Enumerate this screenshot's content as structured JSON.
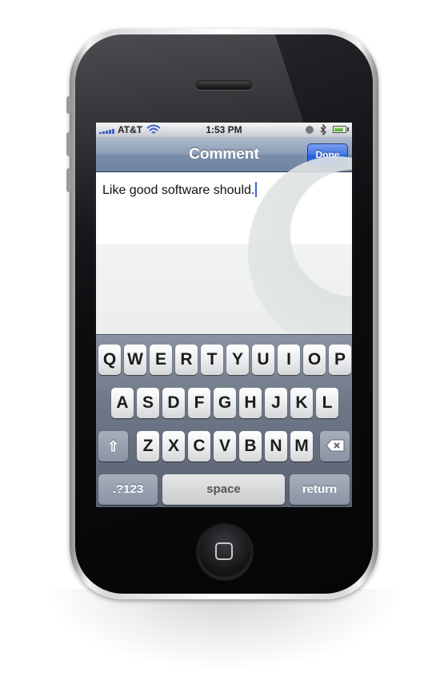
{
  "status_bar": {
    "carrier": "AT&T",
    "time": "1:53 PM",
    "icons": [
      "signal-icon",
      "wifi-icon",
      "alarm-icon",
      "bluetooth-icon",
      "battery-icon"
    ]
  },
  "nav_bar": {
    "title": "Comment",
    "done_label": "Done"
  },
  "comment": {
    "text": "Like good software should."
  },
  "keyboard": {
    "row1": [
      "Q",
      "W",
      "E",
      "R",
      "T",
      "Y",
      "U",
      "I",
      "O",
      "P"
    ],
    "row2": [
      "A",
      "S",
      "D",
      "F",
      "G",
      "H",
      "J",
      "K",
      "L"
    ],
    "row3": [
      "Z",
      "X",
      "C",
      "V",
      "B",
      "N",
      "M"
    ],
    "numbers_label": ".?123",
    "space_label": "space",
    "return_label": "return",
    "shift_icon": "shift-icon",
    "delete_icon": "delete-icon"
  },
  "colors": {
    "nav_accent": "#6d84a2",
    "done_button": "#2e68de",
    "caret": "#3569e3"
  }
}
